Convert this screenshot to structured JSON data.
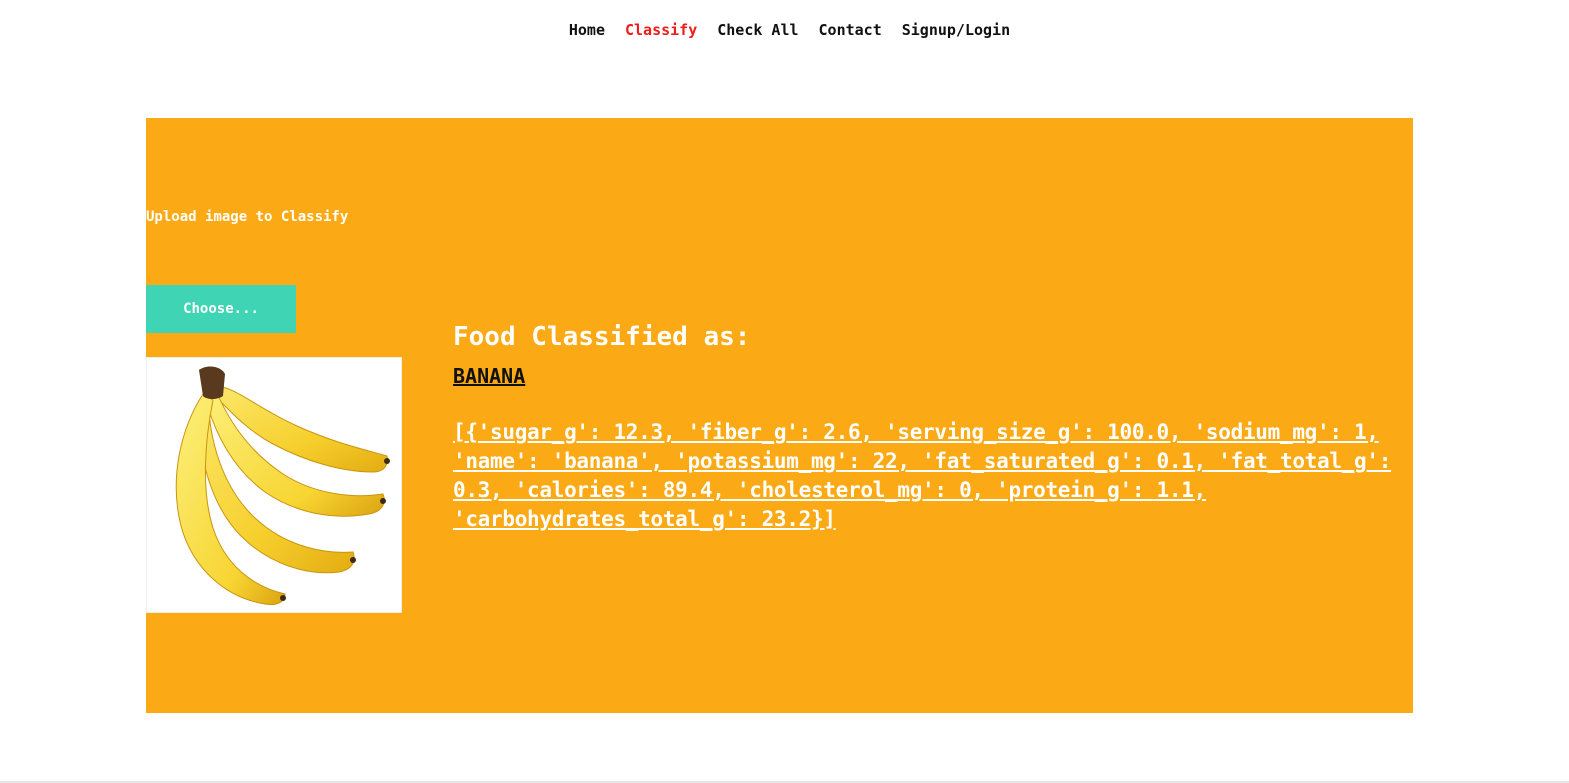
{
  "nav": {
    "items": [
      {
        "label": "Home",
        "active": false
      },
      {
        "label": "Classify",
        "active": true
      },
      {
        "label": "Check All",
        "active": false
      },
      {
        "label": "Contact",
        "active": false
      },
      {
        "label": "Signup/Login",
        "active": false
      }
    ]
  },
  "upload": {
    "label": "Upload image to Classify",
    "button_label": "Choose...",
    "preview_icon": "banana-image"
  },
  "result": {
    "heading": "Food Classified as:",
    "name": "BANANA",
    "nutrition": "[{'sugar_g': 12.3, 'fiber_g': 2.6, 'serving_size_g': 100.0, 'sodium_mg': 1, 'name': 'banana', 'potassium_mg': 22, 'fat_saturated_g': 0.1, 'fat_total_g': 0.3, 'calories': 89.4, 'cholesterol_mg': 0, 'protein_g': 1.1, 'carbohydrates_total_g': 23.2}]"
  },
  "colors": {
    "panel": "#fba914",
    "button": "#3fd4b4",
    "active_nav": "#ee1c1c",
    "text_light": "#ffffff",
    "text_dark": "#111111"
  }
}
